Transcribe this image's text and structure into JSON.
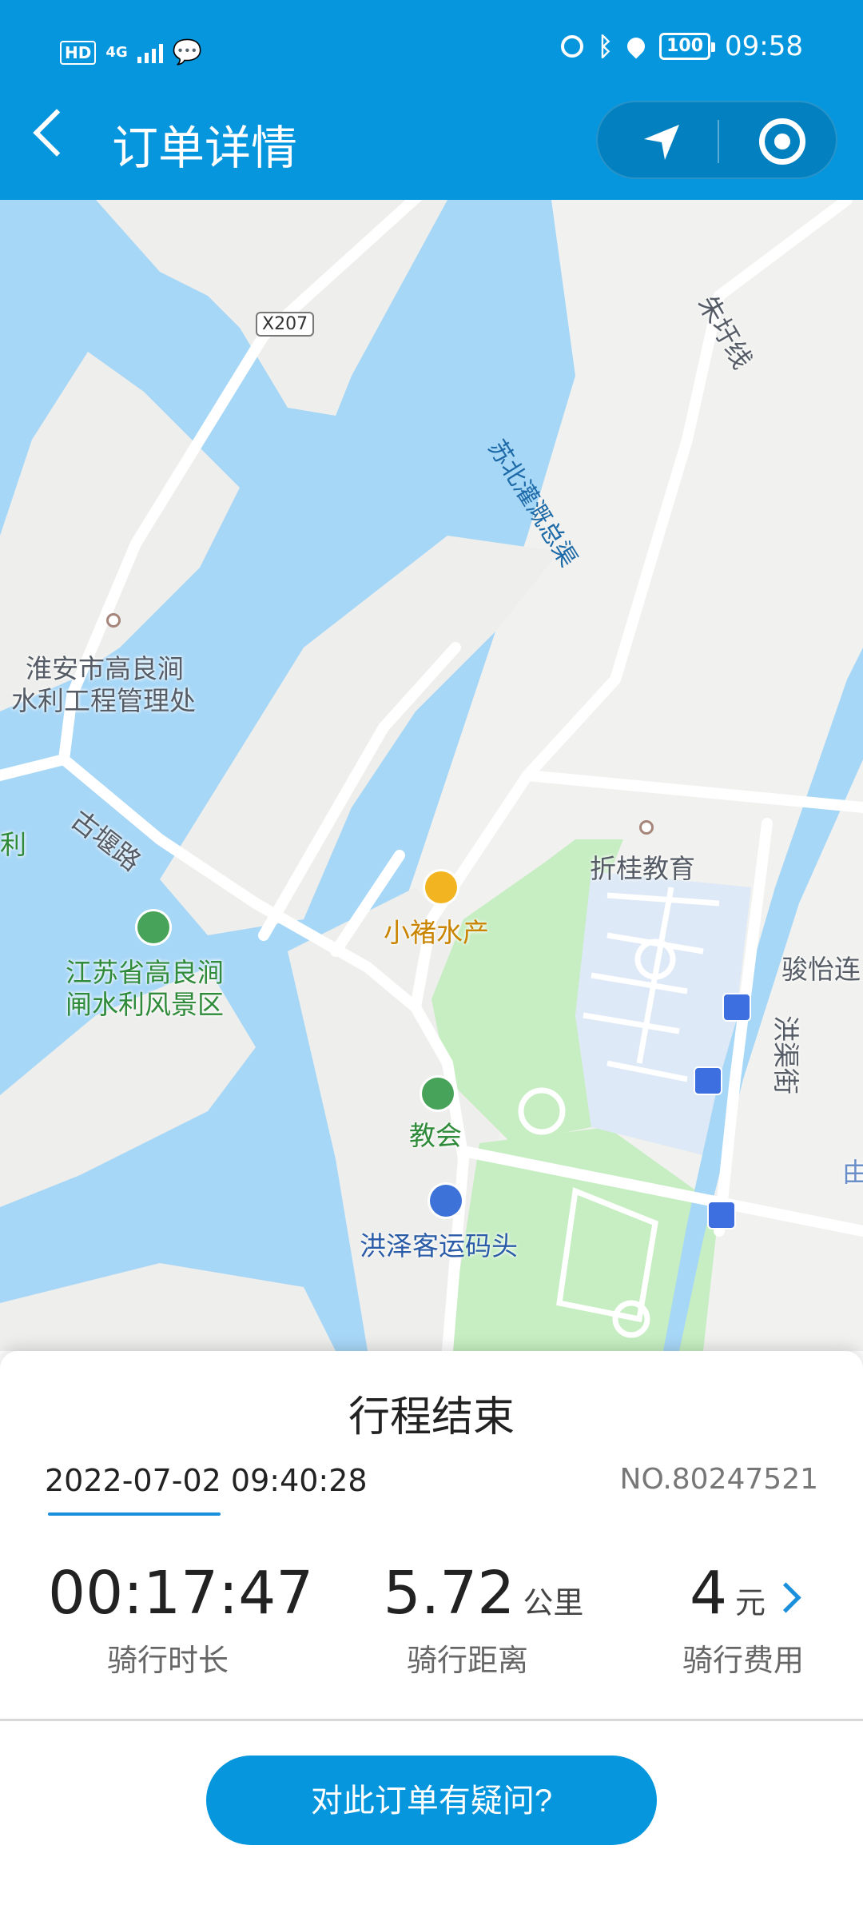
{
  "status_bar": {
    "left_icons": [
      "hd-icon",
      "4g-signal-icon",
      "wechat-icon"
    ],
    "hd": "HD",
    "net": "4G",
    "battery": "100",
    "time": "09:58"
  },
  "header": {
    "title": "订单详情",
    "back_icon": "back-arrow-icon",
    "navigate_icon": "navigation-arrow-icon",
    "locate_icon": "target-circle-icon",
    "bar_color": "#0596dd"
  },
  "map": {
    "labels": {
      "road_x207": "X207",
      "zhu_yu_line": "朱圩线",
      "canal": "苏北灌溉总渠",
      "huaian_office_1": "淮安市高良涧",
      "huaian_office_2": "水利工程管理处",
      "gu_yan_road": "古堰路",
      "li_partial": "利",
      "jiangsu_scenic_1": "江苏省高良涧",
      "jiangsu_scenic_2": "闸水利风景区",
      "xiaozhu": "小褚水产",
      "zhegui": "折桂教育",
      "junyi": "骏怡连",
      "hongqu_street": "洪渠街",
      "jiaohui": "教会",
      "hongze_pier": "洪泽客运码头",
      "edge_char": "由"
    }
  },
  "trip": {
    "status": "行程结束",
    "datetime": "2022-07-02 09:40:28",
    "order_no": "NO.80247521",
    "duration_value": "00:17:47",
    "duration_label": "骑行时长",
    "distance_value": "5.72",
    "distance_unit": "公里",
    "distance_label": "骑行距离",
    "fee_value": "4",
    "fee_unit": "元",
    "fee_label": "骑行费用",
    "question_button": "对此订单有疑问?"
  }
}
